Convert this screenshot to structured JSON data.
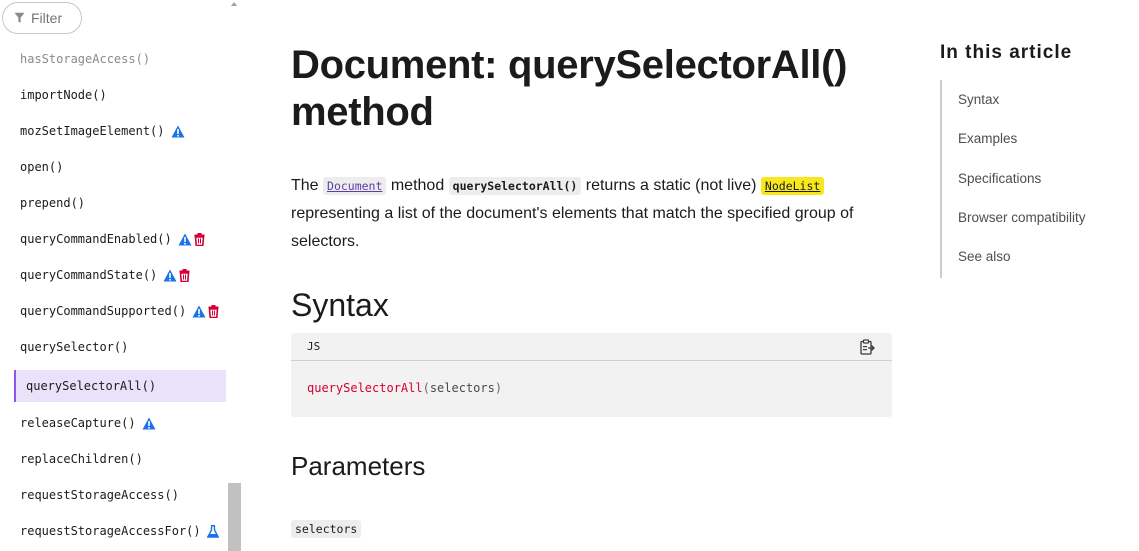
{
  "sidebar": {
    "filter_label": "Filter",
    "items": [
      {
        "label": "hasStorageAccess()",
        "faded": true,
        "icons": []
      },
      {
        "label": "importNode()",
        "icons": []
      },
      {
        "label": "mozSetImageElement()",
        "icons": [
          "warning"
        ]
      },
      {
        "label": "open()",
        "icons": []
      },
      {
        "label": "prepend()",
        "icons": []
      },
      {
        "label": "queryCommandEnabled()",
        "icons": [
          "warning",
          "trash"
        ]
      },
      {
        "label": "queryCommandState()",
        "icons": [
          "warning",
          "trash"
        ]
      },
      {
        "label": "queryCommandSupported()",
        "icons": [
          "warning",
          "trash"
        ]
      },
      {
        "label": "querySelector()",
        "icons": []
      },
      {
        "label": "querySelectorAll()",
        "active": true,
        "icons": []
      },
      {
        "label": "releaseCapture()",
        "icons": [
          "warning"
        ]
      },
      {
        "label": "replaceChildren()",
        "icons": []
      },
      {
        "label": "requestStorageAccess()",
        "icons": []
      },
      {
        "label": "requestStorageAccessFor()",
        "icons": [
          "flask"
        ]
      }
    ]
  },
  "article": {
    "title": "Document: querySelectorAll() method",
    "intro": {
      "p1": "The ",
      "document_link": "Document",
      "p2": " method ",
      "method_code": "querySelectorAll()",
      "p3": " returns a static (not live) ",
      "nodelist_link": "NodeList",
      "p4": " representing a list of the document's elements that match the specified group of selectors."
    },
    "syntax_heading": "Syntax",
    "code": {
      "lang": "JS",
      "fn": "querySelectorAll",
      "open_paren": "(",
      "arg": "selectors",
      "close_paren": ")"
    },
    "parameters_heading": "Parameters",
    "param_term": "selectors"
  },
  "toc": {
    "title": "In this article",
    "items": [
      "Syntax",
      "Examples",
      "Specifications",
      "Browser compatibility",
      "See also"
    ]
  },
  "colors": {
    "active_bg": "#e9e2fb",
    "active_border": "#8f57e6",
    "warning": "#1a73e8",
    "deprecated": "#d30038",
    "highlight": "#f8e71c",
    "code_fn": "#d30038"
  }
}
